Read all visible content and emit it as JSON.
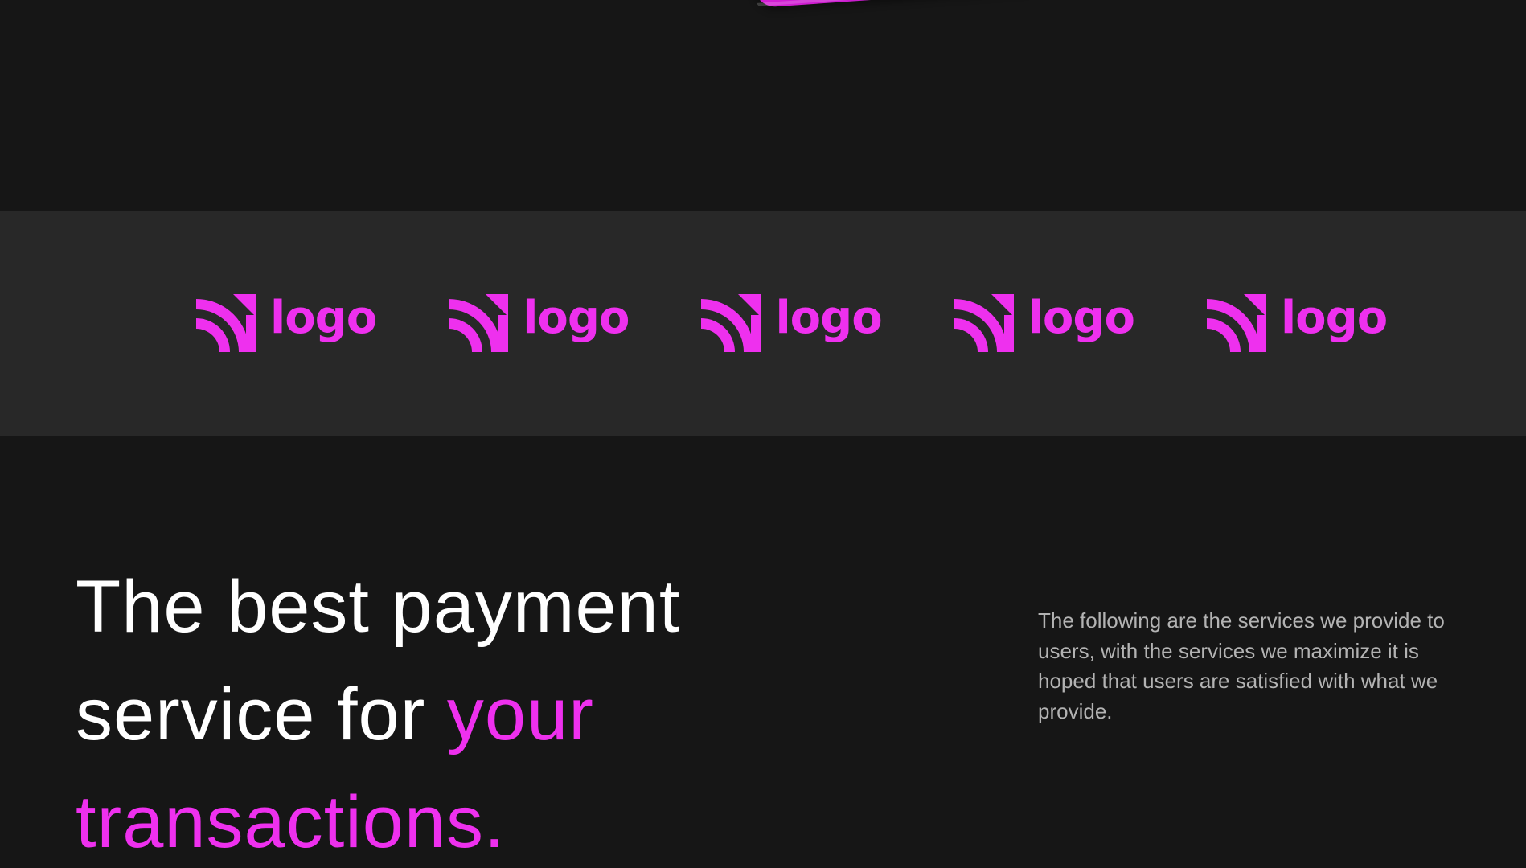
{
  "colors": {
    "background": "#161616",
    "strip_background": "#282828",
    "accent": "#ee30ee",
    "headline_text": "#ffffff",
    "description_text": "#b3b3b3"
  },
  "logos": [
    {
      "text": "logo",
      "icon": "signal-arcs-icon"
    },
    {
      "text": "logo",
      "icon": "signal-arcs-icon"
    },
    {
      "text": "logo",
      "icon": "signal-arcs-icon"
    },
    {
      "text": "logo",
      "icon": "signal-arcs-icon"
    },
    {
      "text": "logo",
      "icon": "signal-arcs-icon"
    }
  ],
  "hero": {
    "headline_part1": "The best payment service for ",
    "headline_accent": "your transactions.",
    "description": "The following are the services we provide to users, with the services we maximize it is hoped that users are satisfied with what we provide."
  }
}
